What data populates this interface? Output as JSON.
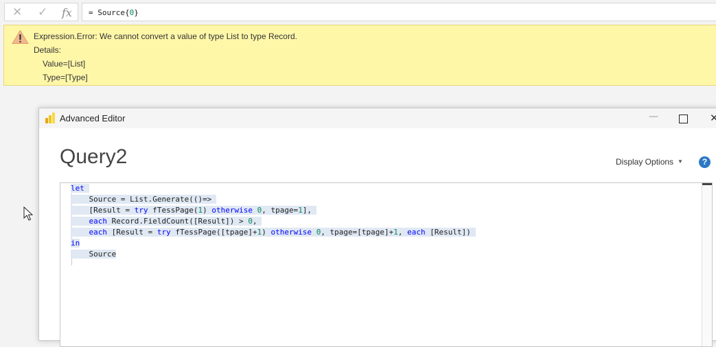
{
  "formula_bar": {
    "cancel_glyph": "✕",
    "commit_glyph": "✓",
    "fx_label": "fx",
    "formula_prefix": "= Source{",
    "formula_index": "0",
    "formula_suffix": "}"
  },
  "error": {
    "title": "Expression.Error: We cannot convert a value of type List to type Record.",
    "details_label": "Details:",
    "detail_value": "Value=[List]",
    "detail_type": "Type=[Type]",
    "icon": "warning-icon"
  },
  "editor": {
    "window_title": "Advanced Editor",
    "query_name": "Query2",
    "display_options_label": "Display Options",
    "help_glyph": "?",
    "min_glyph": "—",
    "close_glyph": "✕",
    "code": {
      "l1_kw": "let",
      "l2": "Source = List.Generate(()=>",
      "l3_a": "[Result = ",
      "l3_try": "try",
      "l3_b": " fTessPage(",
      "l3_n1": "1",
      "l3_c": ") ",
      "l3_otherwise": "otherwise",
      "l3_d": " ",
      "l3_n0": "0",
      "l3_e": ", tpage=",
      "l3_n2": "1",
      "l3_f": "],",
      "l4_each": "each",
      "l4_a": " Record.FieldCount([Result]) > ",
      "l4_n0": "0",
      "l4_b": ",",
      "l5_each": "each",
      "l5_a": " [Result = ",
      "l5_try": "try",
      "l5_b": " fTessPage([tpage]+",
      "l5_n1": "1",
      "l5_c": ") ",
      "l5_otherwise": "otherwise",
      "l5_d": " ",
      "l5_n0": "0",
      "l5_e": ", tpage=[tpage]+",
      "l5_n2": "1",
      "l5_f": ", ",
      "l5_each2": "each",
      "l5_g": " [Result])",
      "l6_kw": "in",
      "l7": "Source"
    }
  },
  "colors": {
    "banner": "#fff7a8",
    "keyword": "#0000ff",
    "number": "#098658",
    "selection": "#dfe8f3"
  }
}
